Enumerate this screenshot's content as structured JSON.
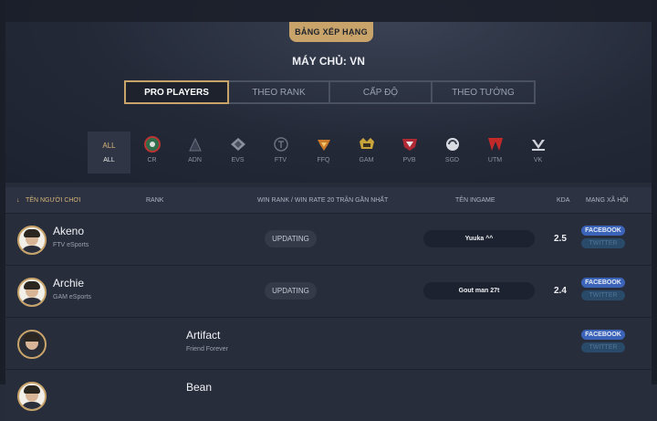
{
  "header": {
    "badge": "BẢNG XẾP HẠNG",
    "server_label": "MÁY CHỦ: VN"
  },
  "tabs": [
    {
      "label": "PRO PLAYERS",
      "active": true
    },
    {
      "label": "THEO RANK",
      "active": false
    },
    {
      "label": "CẤP ĐỘ",
      "active": false
    },
    {
      "label": "THEO TƯỚNG",
      "active": false
    }
  ],
  "teams": {
    "all": {
      "label_top": "ALL",
      "label_bottom": "ALL"
    },
    "list": [
      "CR",
      "ADN",
      "EVS",
      "FTV",
      "FFQ",
      "GAM",
      "PVB",
      "SGD",
      "UTM",
      "VK"
    ]
  },
  "table": {
    "headers": {
      "name": "TÊN NGƯỜI CHƠI",
      "rank": "RANK",
      "winrate": "WIN RANK / WIN RATE 20 TRẬN GẦN NHẤT",
      "ingame": "TÊN INGAME",
      "kda": "KDA",
      "social": "MẠNG XÃ HỘI"
    },
    "rows": [
      {
        "name": "Akeno",
        "team": "FTV eSports",
        "status": "UPDATING",
        "ingame": "Yuuka ^^",
        "kda": "2.5",
        "facebook": "FACEBOOK",
        "twitter": "TWITTER"
      },
      {
        "name": "Archie",
        "team": "GAM eSports",
        "status": "UPDATING",
        "ingame": "Gout man 27t",
        "kda": "2.4",
        "facebook": "FACEBOOK",
        "twitter": "TWITTER"
      },
      {
        "name": "Artifact",
        "team": "Friend Forever",
        "facebook": "FACEBOOK",
        "twitter": "TWITTER"
      },
      {
        "name": "Bean"
      }
    ]
  },
  "colors": {
    "gold": "#c9a46a",
    "facebook": "#3b63b8",
    "twitter": "#2a4a6a"
  }
}
